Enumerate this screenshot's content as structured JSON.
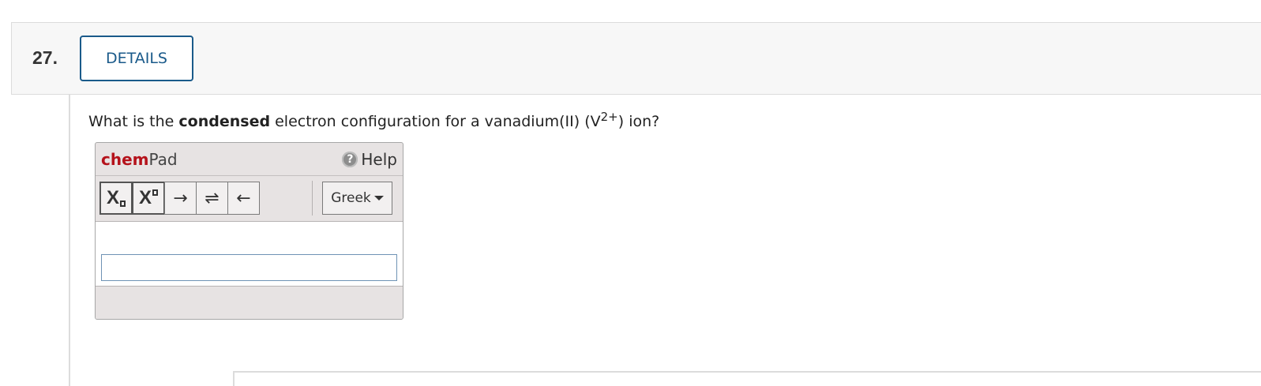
{
  "question": {
    "number": "27.",
    "details_label": "DETAILS",
    "prompt": {
      "part1": "What is the ",
      "bold": "condensed",
      "part2": " electron configuration for a vanadium(II) (V",
      "superscript": "2+",
      "part3": ") ion?"
    }
  },
  "chempad": {
    "logo_chem": "chem",
    "logo_pad": "Pad",
    "help_icon_glyph": "?",
    "help_label": "Help",
    "toolbar": {
      "subscript_label": "X",
      "superscript_label": "X",
      "right_arrow_glyph": "→",
      "equilibrium_glyph": "⇌",
      "left_arrow_glyph": "←",
      "greek_label": "Greek"
    },
    "input_value": "",
    "input_placeholder": ""
  },
  "colors": {
    "accent_blue": "#1a5a8a",
    "chem_red": "#b5121b",
    "header_bg": "#f7f7f7",
    "pad_bg": "#e7e3e3"
  }
}
